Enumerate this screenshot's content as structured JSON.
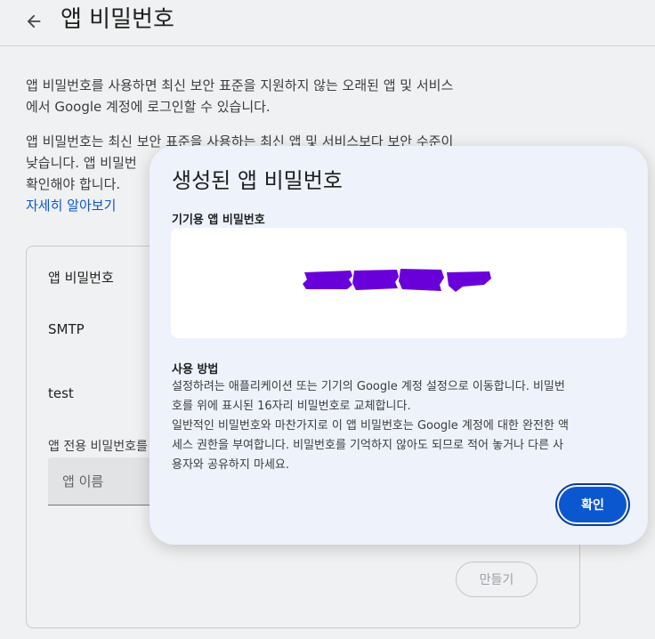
{
  "header": {
    "title": "앱 비밀번호"
  },
  "intro": {
    "para1_line1": "앱 비밀번호를 사용하면 최신 보안 표준을 지원하지 않는 오래된 앱 및 서비스",
    "para1_line2": "에서 Google 계정에 로그인할 수 있습니다.",
    "para2_line1": "앱 비밀번호는 최신 보안 표준을 사용하는 최신 앱 및 서비스보다 보안 수준이",
    "para2_line2": "낮습니다. 앱 비밀번",
    "para2_line3": "확인해야 합니다.",
    "learn_more": "자세히 알아보기"
  },
  "card": {
    "title": "앱 비밀번호",
    "passwords": [
      "SMTP",
      "test"
    ],
    "create_label": "앱 전용 비밀번호를",
    "app_name_placeholder": "앱 이름",
    "create_button": "만들기"
  },
  "dialog": {
    "title": "생성된 앱 비밀번호",
    "subtitle": "기기용 앱 비밀번호",
    "password_redacted": true,
    "howto_title": "사용 방법",
    "howto_lines": [
      "설정하려는 애플리케이션 또는 기기의 Google 계정 설정으로 이동합니다. 비밀번",
      "호를 위에 표시된 16자리 비밀번호로 교체합니다.",
      "일반적인 비밀번호와 마찬가지로 이 앱 비밀번호는 Google 계정에 대한 완전한 액",
      "세스 권한을 부여합니다. 비밀번호를 기억하지 않아도 되므로 적어 놓거나 다른 사",
      "용자와 공유하지 마세요."
    ],
    "confirm_button": "확인"
  },
  "colors": {
    "accent": "#0b57d0",
    "redaction": "#6a00d9",
    "dialog_bg": "#edf2fb"
  }
}
